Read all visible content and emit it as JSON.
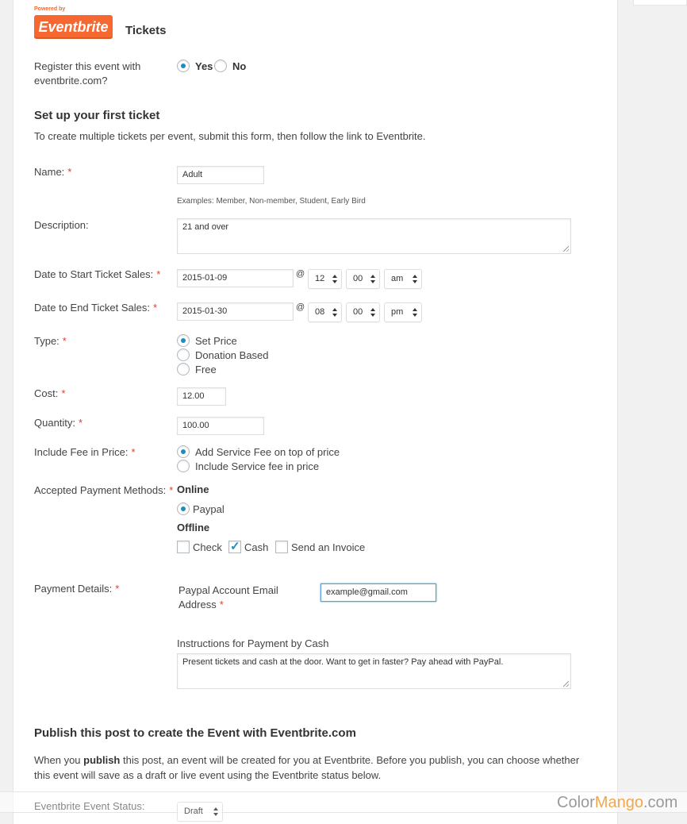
{
  "logo": {
    "powered_by": "Powered by",
    "brand": "Eventbrite",
    "tm": "TM"
  },
  "section_title": "Tickets",
  "register": {
    "label": "Register this event with eventbrite.com?",
    "yes": "Yes",
    "no": "No",
    "selected": "Yes"
  },
  "first_ticket": {
    "heading": "Set up your first ticket",
    "note": "To create multiple tickets per event, submit this form, then follow the link to Eventbrite."
  },
  "name": {
    "label": "Name:",
    "value": "Adult",
    "hint": "Examples: Member, Non-member, Student, Early Bird"
  },
  "description": {
    "label": "Description:",
    "value": "21 and over"
  },
  "start_sales": {
    "label": "Date to Start Ticket Sales:",
    "date": "2015-01-09",
    "at": "@",
    "hour": "12",
    "minute": "00",
    "ampm": "am"
  },
  "end_sales": {
    "label": "Date to End Ticket Sales:",
    "date": "2015-01-30",
    "at": "@",
    "hour": "08",
    "minute": "00",
    "ampm": "pm"
  },
  "type": {
    "label": "Type:",
    "options": [
      "Set Price",
      "Donation Based",
      "Free"
    ],
    "selected": "Set Price"
  },
  "cost": {
    "label": "Cost:",
    "value": "12.00"
  },
  "quantity": {
    "label": "Quantity:",
    "value": "100.00"
  },
  "fee": {
    "label": "Include Fee in Price:",
    "options": [
      "Add Service Fee on top of price",
      "Include Service fee in price"
    ],
    "selected": "Add Service Fee on top of price"
  },
  "payment_methods": {
    "label": "Accepted Payment Methods:",
    "online_heading": "Online",
    "online_option": "Paypal",
    "offline_heading": "Offline",
    "offline_options": [
      {
        "label": "Check",
        "checked": false
      },
      {
        "label": "Cash",
        "checked": true
      },
      {
        "label": "Send an Invoice",
        "checked": false
      }
    ]
  },
  "payment_details": {
    "label": "Payment Details:",
    "paypal_label": "Paypal Account Email Address",
    "paypal_value": "example@gmail.com",
    "cash_label": "Instructions for Payment by Cash",
    "cash_value": "Present tickets and cash at the door. Want to get in faster? Pay ahead with PayPal."
  },
  "publish": {
    "heading": "Publish this post to create the Event with Eventbrite.com",
    "text_before": "When you ",
    "text_bold": "publish",
    "text_after": " this post, an event will be created for you at Eventbrite. Before you publish, you can choose whether this event will save as a draft or live event using the Eventbrite status below."
  },
  "status": {
    "label": "Eventbrite Event Status:",
    "value": "Draft"
  },
  "watermark": {
    "part1": "Color",
    "part2": "Mango",
    "part3": ".com"
  },
  "colors": {
    "accent": "#1e8cbe",
    "brand": "#f6682f",
    "required": "#dd3d36"
  }
}
